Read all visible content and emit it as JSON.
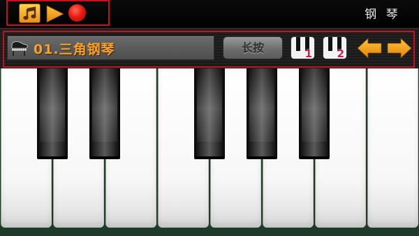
{
  "header": {
    "title": "钢 琴",
    "music_icon": "music-note-icon",
    "play_icon": "play-icon",
    "record_icon": "record-icon"
  },
  "controls": {
    "instrument_icon": "grand-piano-icon",
    "instrument_name": "01.三角钢琴",
    "sustain_label": "长按",
    "layout_buttons": [
      {
        "label": "1",
        "icon": "keyboard-layout-icon"
      },
      {
        "label": "2",
        "icon": "keyboard-layout-icon"
      }
    ],
    "prev_icon": "arrow-left-icon",
    "next_icon": "arrow-right-icon"
  },
  "keyboard": {
    "white_keys": 8,
    "black_keys": 5
  },
  "colors": {
    "accent_orange": "#f6a12a",
    "record_red": "#e81b12",
    "highlight_border": "#c8101c",
    "layout_number": "#c81d5a",
    "floor_green": "#1e3a28"
  }
}
